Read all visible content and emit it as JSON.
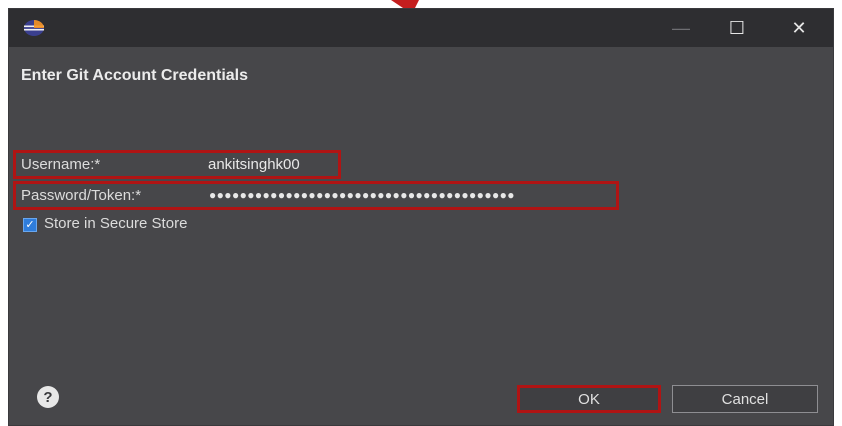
{
  "window": {
    "icons": {
      "app": "eclipse-logo-icon",
      "minimize": "minimize-icon",
      "maximize": "maximize-icon",
      "close": "close-icon"
    },
    "minimize_glyph": "—",
    "maximize_glyph": "☐",
    "close_glyph": "✕"
  },
  "dialog": {
    "title": "Enter Git Account Credentials",
    "username_label": "Username:*",
    "username_value": "ankitsinghk00",
    "password_label": "Password/Token:*",
    "password_value": "●●●●●●●●●●●●●●●●●●●●●●●●●●●●●●●●●●●●●●●●",
    "store_label": "Store in Secure Store",
    "store_checked": true,
    "checkbox_glyph": "✓",
    "help_glyph": "?",
    "help_icon": "help-icon",
    "ok_label": "OK",
    "cancel_label": "Cancel"
  },
  "colors": {
    "background": "#47474a",
    "titlebar": "#2e2e31",
    "highlight": "#b01414",
    "checkbox": "#2f7ddb"
  }
}
